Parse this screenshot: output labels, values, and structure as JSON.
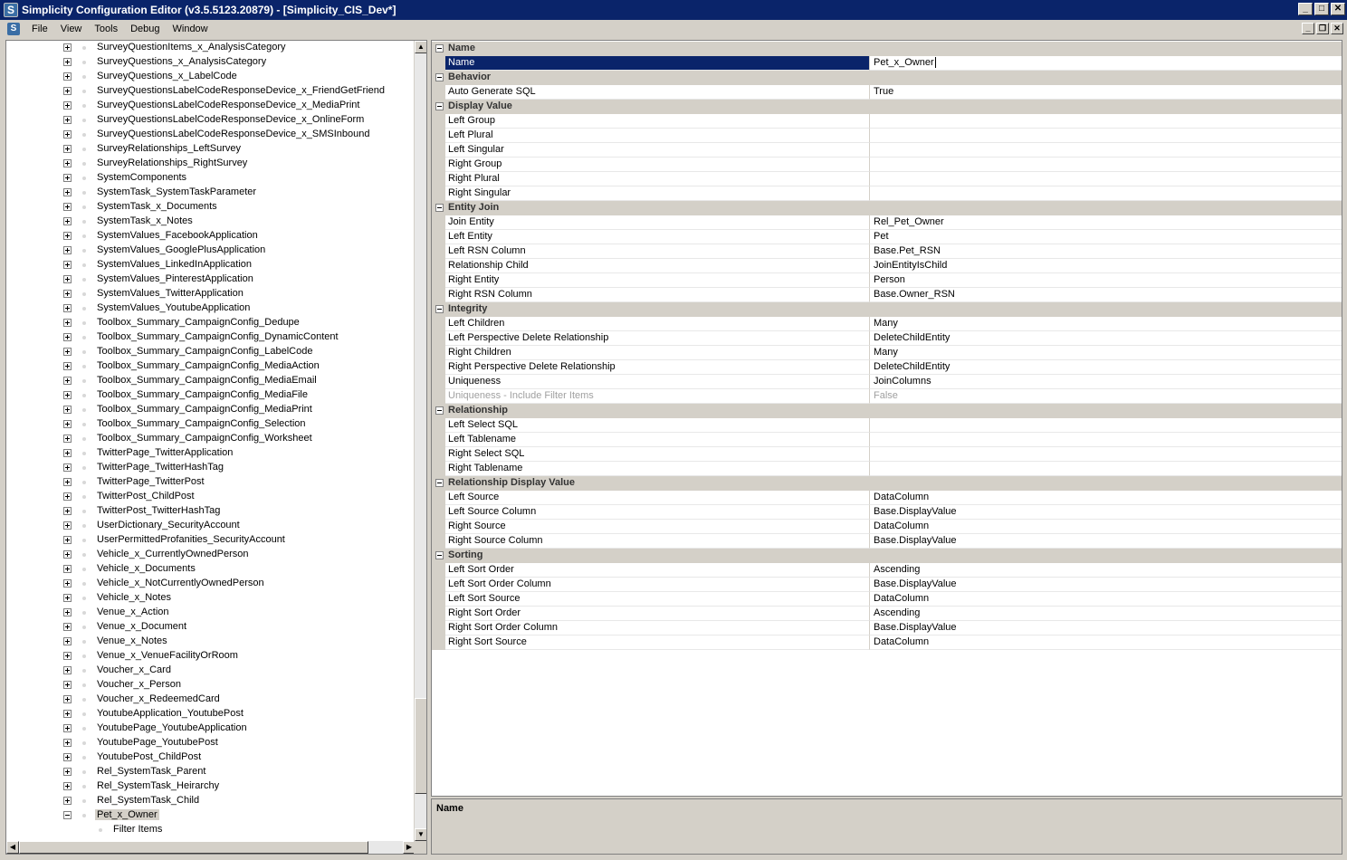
{
  "window": {
    "title": "Simplicity Configuration Editor (v3.5.5123.20879) - [Simplicity_CIS_Dev*]",
    "app_icon": "S",
    "buttons": {
      "minimize": "_",
      "maximize": "□",
      "close": "✕"
    }
  },
  "menubar": {
    "items": [
      "File",
      "View",
      "Tools",
      "Debug",
      "Window"
    ],
    "mdi_buttons": {
      "minimize": "_",
      "restore": "❐",
      "close": "✕"
    }
  },
  "tree": {
    "items": [
      "SurveyQuestionItems_x_AnalysisCategory",
      "SurveyQuestions_x_AnalysisCategory",
      "SurveyQuestions_x_LabelCode",
      "SurveyQuestionsLabelCodeResponseDevice_x_FriendGetFriend",
      "SurveyQuestionsLabelCodeResponseDevice_x_MediaPrint",
      "SurveyQuestionsLabelCodeResponseDevice_x_OnlineForm",
      "SurveyQuestionsLabelCodeResponseDevice_x_SMSInbound",
      "SurveyRelationships_LeftSurvey",
      "SurveyRelationships_RightSurvey",
      "SystemComponents",
      "SystemTask_SystemTaskParameter",
      "SystemTask_x_Documents",
      "SystemTask_x_Notes",
      "SystemValues_FacebookApplication",
      "SystemValues_GooglePlusApplication",
      "SystemValues_LinkedInApplication",
      "SystemValues_PinterestApplication",
      "SystemValues_TwitterApplication",
      "SystemValues_YoutubeApplication",
      "Toolbox_Summary_CampaignConfig_Dedupe",
      "Toolbox_Summary_CampaignConfig_DynamicContent",
      "Toolbox_Summary_CampaignConfig_LabelCode",
      "Toolbox_Summary_CampaignConfig_MediaAction",
      "Toolbox_Summary_CampaignConfig_MediaEmail",
      "Toolbox_Summary_CampaignConfig_MediaFile",
      "Toolbox_Summary_CampaignConfig_MediaPrint",
      "Toolbox_Summary_CampaignConfig_Selection",
      "Toolbox_Summary_CampaignConfig_Worksheet",
      "TwitterPage_TwitterApplication",
      "TwitterPage_TwitterHashTag",
      "TwitterPage_TwitterPost",
      "TwitterPost_ChildPost",
      "TwitterPost_TwitterHashTag",
      "UserDictionary_SecurityAccount",
      "UserPermittedProfanities_SecurityAccount",
      "Vehicle_x_CurrentlyOwnedPerson",
      "Vehicle_x_Documents",
      "Vehicle_x_NotCurrentlyOwnedPerson",
      "Vehicle_x_Notes",
      "Venue_x_Action",
      "Venue_x_Document",
      "Venue_x_Notes",
      "Venue_x_VenueFacilityOrRoom",
      "Voucher_x_Card",
      "Voucher_x_Person",
      "Voucher_x_RedeemedCard",
      "YoutubeApplication_YoutubePost",
      "YoutubePage_YoutubeApplication",
      "YoutubePage_YoutubePost",
      "YoutubePost_ChildPost",
      "Rel_SystemTask_Parent",
      "Rel_SystemTask_Heirarchy",
      "Rel_SystemTask_Child"
    ],
    "selected_item": "Pet_x_Owner",
    "selected_child": "Filter Items"
  },
  "properties": [
    {
      "category": "Name"
    },
    {
      "name": "Name",
      "value": "Pet_x_Owner",
      "selected": true
    },
    {
      "category": "Behavior"
    },
    {
      "name": "Auto Generate SQL",
      "value": "True"
    },
    {
      "category": "Display Value"
    },
    {
      "name": "Left Group",
      "value": ""
    },
    {
      "name": "Left Plural",
      "value": ""
    },
    {
      "name": "Left Singular",
      "value": ""
    },
    {
      "name": "Right Group",
      "value": ""
    },
    {
      "name": "Right Plural",
      "value": ""
    },
    {
      "name": "Right Singular",
      "value": ""
    },
    {
      "category": "Entity Join"
    },
    {
      "name": "Join Entity",
      "value": "Rel_Pet_Owner"
    },
    {
      "name": "Left Entity",
      "value": "Pet"
    },
    {
      "name": "Left RSN Column",
      "value": "Base.Pet_RSN"
    },
    {
      "name": "Relationship Child",
      "value": "JoinEntityIsChild"
    },
    {
      "name": "Right Entity",
      "value": "Person"
    },
    {
      "name": "Right RSN Column",
      "value": "Base.Owner_RSN"
    },
    {
      "category": "Integrity"
    },
    {
      "name": "Left Children",
      "value": "Many"
    },
    {
      "name": "Left Perspective Delete Relationship",
      "value": "DeleteChildEntity"
    },
    {
      "name": "Right Children",
      "value": "Many"
    },
    {
      "name": "Right Perspective Delete Relationship",
      "value": "DeleteChildEntity"
    },
    {
      "name": "Uniqueness",
      "value": "JoinColumns"
    },
    {
      "name": "Uniqueness - Include Filter Items",
      "value": "False",
      "disabled": true
    },
    {
      "category": "Relationship"
    },
    {
      "name": "Left Select SQL",
      "value": ""
    },
    {
      "name": "Left Tablename",
      "value": ""
    },
    {
      "name": "Right Select SQL",
      "value": ""
    },
    {
      "name": "Right Tablename",
      "value": ""
    },
    {
      "category": "Relationship Display Value"
    },
    {
      "name": "Left Source",
      "value": "DataColumn"
    },
    {
      "name": "Left Source Column",
      "value": "Base.DisplayValue"
    },
    {
      "name": "Right Source",
      "value": "DataColumn"
    },
    {
      "name": "Right Source Column",
      "value": "Base.DisplayValue"
    },
    {
      "category": "Sorting"
    },
    {
      "name": "Left Sort Order",
      "value": "Ascending"
    },
    {
      "name": "Left Sort Order Column",
      "value": "Base.DisplayValue"
    },
    {
      "name": "Left Sort Source",
      "value": "DataColumn"
    },
    {
      "name": "Right Sort Order",
      "value": "Ascending"
    },
    {
      "name": "Right Sort Order Column",
      "value": "Base.DisplayValue"
    },
    {
      "name": "Right Sort Source",
      "value": "DataColumn"
    }
  ],
  "description": {
    "title": "Name"
  },
  "colors": {
    "titlebar": "#0a246a",
    "selection": "#0a246a",
    "chrome": "#d4d0c8"
  }
}
